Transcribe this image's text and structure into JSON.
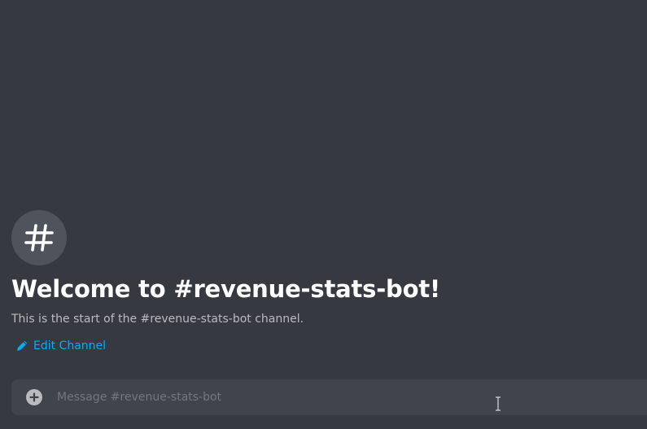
{
  "channel": {
    "icon": "hashtag-icon",
    "welcome_title": "Welcome to #revenue-stats-bot!",
    "welcome_subtitle": "This is the start of the #revenue-stats-bot channel.",
    "edit_label": "Edit Channel"
  },
  "composer": {
    "placeholder": "Message #revenue-stats-bot",
    "attach_icon": "plus-circle-icon"
  },
  "colors": {
    "background": "#36393f",
    "avatar_bg": "#4f545c",
    "composer_bg": "#40444b",
    "link": "#00aff4",
    "text_muted": "#b9bbbe",
    "placeholder": "#72767d"
  }
}
